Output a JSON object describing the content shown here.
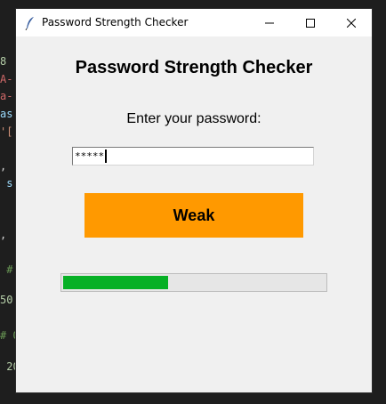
{
  "window": {
    "title": "Password Strength Checker",
    "controls": {
      "minimize": "minimize",
      "maximize": "maximize",
      "close": "close"
    }
  },
  "app": {
    "heading": "Password Strength Checker",
    "prompt": "Enter your password:",
    "password_value": "*****",
    "strength_label": "Weak",
    "strength_color": "#ff9900",
    "progress_fraction": 0.4,
    "progress_color": "#06b025"
  },
  "background_code": {
    "lines": [
      {
        "text": "8",
        "color": "#b5cea8"
      },
      {
        "text": "A-",
        "color": "#d16969"
      },
      {
        "text": "a-",
        "color": "#d16969"
      },
      {
        "text": "as",
        "color": "#9cdcfe"
      },
      {
        "text": "'[",
        "color": "#ce9178"
      },
      {
        "text": ",",
        "color": "#d4d4d4"
      },
      {
        "text": " s",
        "color": "#9cdcfe"
      },
      {
        "text": ",",
        "color": "#d4d4d4"
      },
      {
        "text": " #",
        "color": "#6a9955"
      },
      {
        "text": "50",
        "color": "#b5cea8"
      },
      {
        "text": "# O",
        "color": "#6a9955"
      },
      {
        "text": " 20",
        "color": "#b5cea8"
      }
    ]
  }
}
